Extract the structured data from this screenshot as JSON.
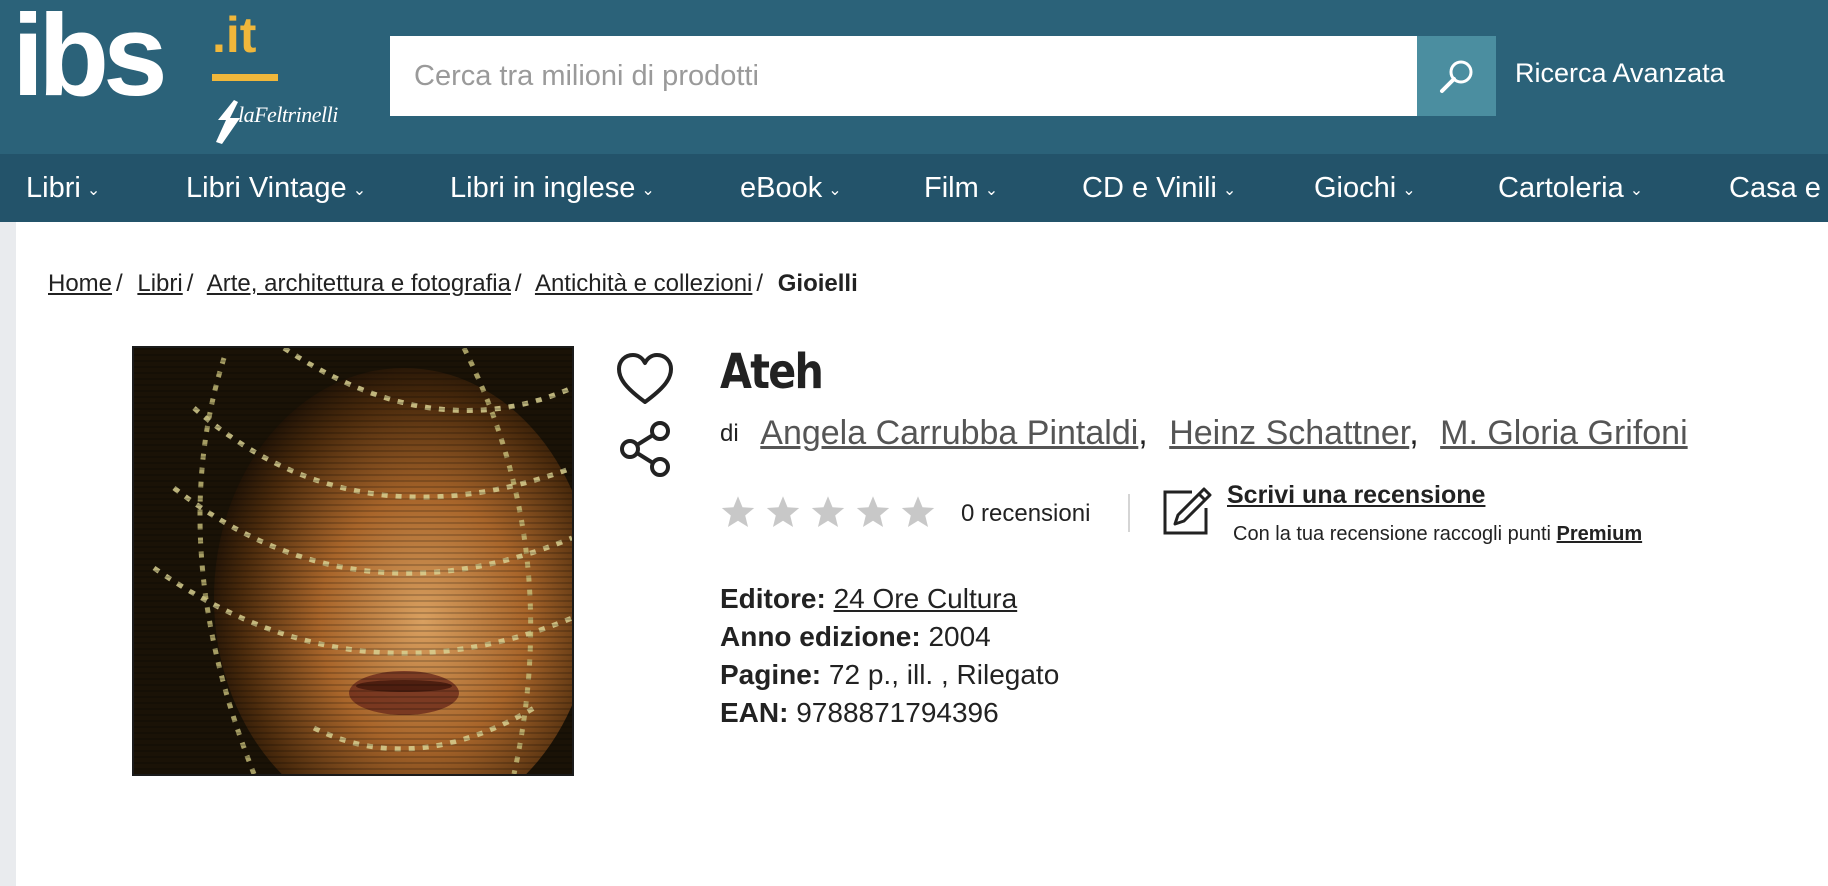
{
  "header": {
    "logo": {
      "main": "ibs",
      "suffix": ".it",
      "sub": "laFeltrinelli"
    },
    "search": {
      "placeholder": "Cerca tra milioni di prodotti",
      "value": ""
    },
    "advanced_search": "Ricerca Avanzata"
  },
  "nav": {
    "items": [
      {
        "label": "Libri"
      },
      {
        "label": "Libri Vintage"
      },
      {
        "label": "Libri in inglese"
      },
      {
        "label": "eBook"
      },
      {
        "label": "Film"
      },
      {
        "label": "CD e Vinili"
      },
      {
        "label": "Giochi"
      },
      {
        "label": "Cartoleria"
      },
      {
        "label": "Casa e c"
      }
    ]
  },
  "breadcrumb": {
    "items": [
      "Home",
      "Libri",
      "Arte, architettura e fotografia",
      "Antichità e collezioni"
    ],
    "current": "Gioielli"
  },
  "product": {
    "title": "Ateh",
    "by_label": "di",
    "authors": [
      "Angela Carrubba Pintaldi",
      "Heinz Schattner",
      "M. Gloria Grifoni"
    ],
    "rating": {
      "stars_filled": 0,
      "stars_total": 5,
      "count_text": "0 recensioni"
    },
    "write_review": "Scrivi una recensione",
    "review_note": "Con la tua recensione raccogli punti",
    "review_note_link": "Premium",
    "details": {
      "editore_label": "Editore:",
      "editore": "24 Ore Cultura",
      "anno_label": "Anno edizione:",
      "anno": "2004",
      "pagine_label": "Pagine:",
      "pagine": "72 p., ill. , Rilegato",
      "ean_label": "EAN:",
      "ean": "9788871794396"
    }
  },
  "colors": {
    "header_bg": "#2b6279",
    "nav_bg": "#23536a",
    "search_button": "#4b8ea0",
    "logo_accent": "#f0b73b",
    "star_empty": "#c8c8c8"
  },
  "icons": [
    "search-icon",
    "heart-icon",
    "share-icon",
    "star-icon",
    "pencil-icon",
    "chevron-down-icon"
  ]
}
